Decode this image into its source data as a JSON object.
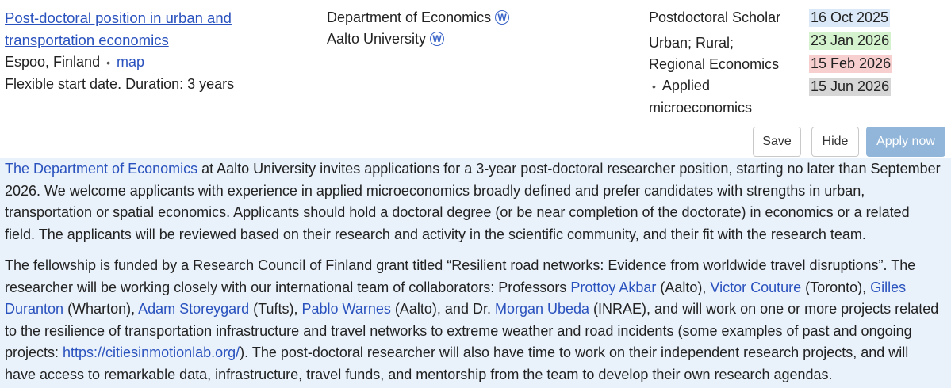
{
  "job": {
    "title": "Post-doctoral position in urban and transportation economics",
    "location": "Espoo, Finland",
    "map_link": "map",
    "start_info": "Flexible start date. Duration: 3 years"
  },
  "org": {
    "department": "Department of Economics",
    "university": "Aalto University",
    "wiki_badge": "W"
  },
  "position": {
    "type": "Postdoctoral Scholar",
    "fields_line1": "Urban; Rural;",
    "fields_line2": "Regional Economics",
    "fields_line3": "Applied",
    "fields_line4": "microeconomics"
  },
  "dates": {
    "posted": "16 Oct 2025",
    "d2": "23 Jan 2026",
    "d3": "15 Feb 2026",
    "d4": "15 Jun 2026"
  },
  "actions": {
    "save": "Save",
    "hide": "Hide",
    "apply": "Apply now"
  },
  "description": {
    "p1_link": "The Department of Economics",
    "p1_text": " at Aalto University invites applications for a 3-year post-doctoral researcher position, starting no later than September 2026. We welcome applicants with experience in applied microeconomics broadly defined and prefer candidates with strengths in urban, transportation or spatial economics. Applicants should hold a doctoral degree (or be near completion of the doctorate) in economics or a related field. The applicants will be reviewed based on their research and activity in the scientific community, and their fit with the research team.",
    "p2_a": "The fellowship is funded by a Research Council of Finland grant titled “Resilient road networks: Evidence from worldwide travel disruptions”. The researcher will be working closely with our international team of collaborators: Professors ",
    "name1": "Prottoy Akbar",
    "t1": " (Aalto), ",
    "name2": "Victor Couture",
    "t2": " (Toronto), ",
    "name3": "Gilles Duranton",
    "t3": " (Wharton), ",
    "name4": "Adam Storeygard",
    "t4": " (Tufts), ",
    "name5": "Pablo Warnes",
    "t5": " (Aalto), and Dr. ",
    "name6": "Morgan Ubeda",
    "t6": " (INRAE), and will work on one or more projects related to the resilience of transportation infrastructure and travel networks to extreme weather and road incidents (some examples of past and ongoing projects: ",
    "url": "https://citiesinmotionlab.org/",
    "t7": "). The post-doctoral researcher will also have time to work on their independent research projects, and will have access to remarkable data, infrastructure, travel funds, and mentorship from the team to develop their own research agendas."
  }
}
